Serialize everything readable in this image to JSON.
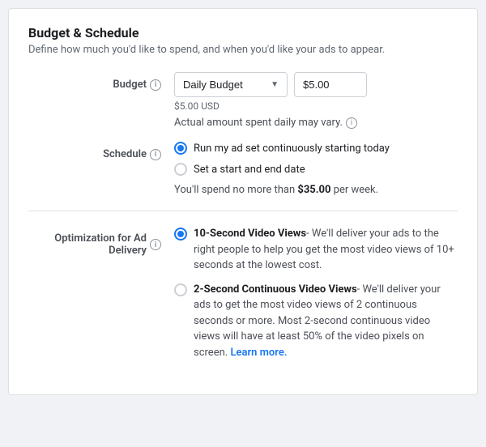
{
  "section": {
    "title": "Budget & Schedule",
    "subtitle": "Define how much you'd like to spend, and when you'd like your ads to appear."
  },
  "budget": {
    "label": "Budget",
    "dropdown_value": "Daily Budget",
    "amount": "$5.00",
    "currency": "$5.00 USD",
    "vary_note": "Actual amount spent daily may vary."
  },
  "schedule": {
    "label": "Schedule",
    "options": [
      {
        "label": "Run my ad set continuously starting today",
        "selected": true
      },
      {
        "label": "Set a start and end date",
        "selected": false
      }
    ],
    "weekly_note_prefix": "You'll spend no more than ",
    "weekly_amount": "$35.00",
    "weekly_note_suffix": " per week."
  },
  "optimization": {
    "label": "Optimization for Ad Delivery",
    "options": [
      {
        "title": "10-Second Video Views",
        "description": "We'll deliver your ads to the right people to help you get the most video views of 10+ seconds at the lowest cost.",
        "selected": true,
        "learn_more": false
      },
      {
        "title": "2-Second Continuous Video Views",
        "description": "We'll deliver your ads to get the most video views of 2 continuous seconds or more. Most 2-second continuous video views will have at least 50% of the video pixels on screen.",
        "selected": false,
        "learn_more": true,
        "learn_more_label": "Learn more."
      }
    ]
  }
}
